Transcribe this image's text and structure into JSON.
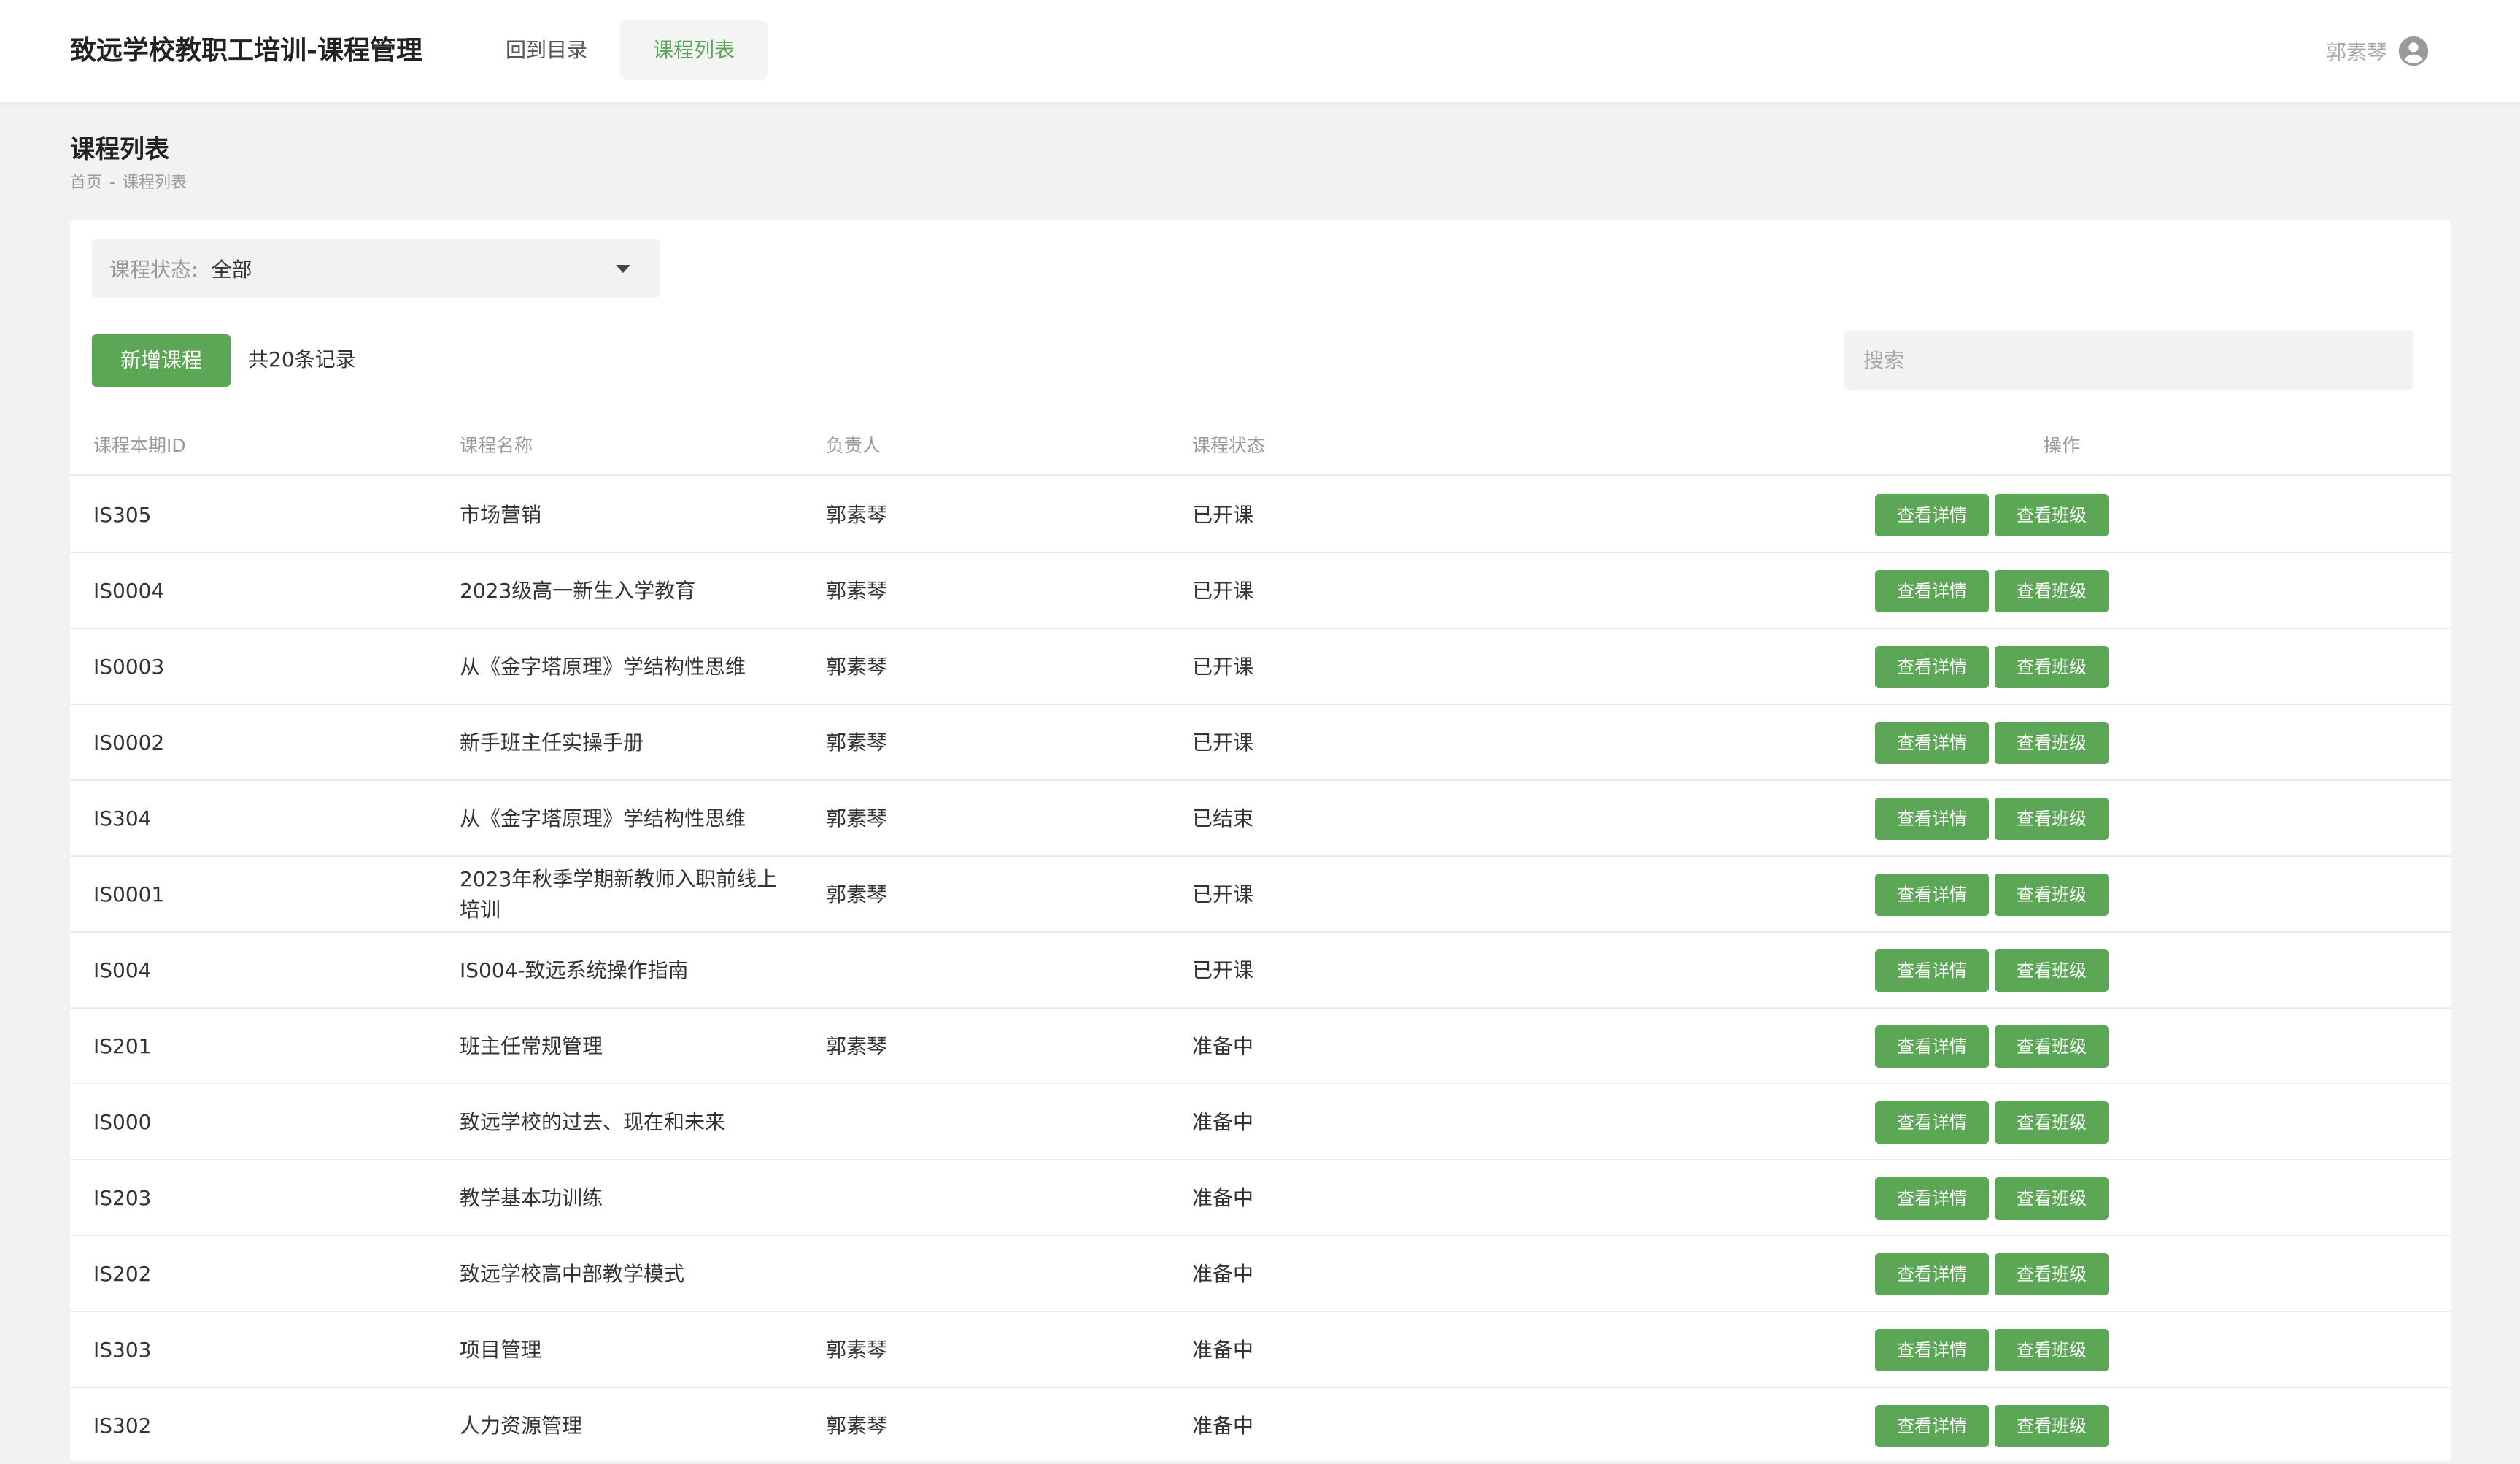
{
  "header": {
    "app_title": "致远学校教职工培训-课程管理",
    "nav": [
      {
        "label": "回到目录",
        "active": false
      },
      {
        "label": "课程列表",
        "active": true
      }
    ],
    "user_name": "郭素琴",
    "user_icon": "account-circle-icon"
  },
  "page": {
    "title": "课程列表",
    "breadcrumb": [
      "首页",
      "-",
      "课程列表"
    ]
  },
  "filter": {
    "label": "课程状态:",
    "value": "全部",
    "icon": "caret-down-icon"
  },
  "toolbar": {
    "add_label": "新增课程",
    "total_text": "共20条记录",
    "search_placeholder": "搜索"
  },
  "table": {
    "columns": [
      "课程本期ID",
      "课程名称",
      "负责人",
      "课程状态",
      "操作"
    ],
    "action_labels": {
      "detail": "查看详情",
      "class": "查看班级"
    },
    "rows": [
      {
        "id": "IS305",
        "name": "市场营销",
        "owner": "郭素琴",
        "status": "已开课"
      },
      {
        "id": "IS0004",
        "name": "2023级高一新生入学教育",
        "owner": "郭素琴",
        "status": "已开课"
      },
      {
        "id": "IS0003",
        "name": "从《金字塔原理》学结构性思维",
        "owner": "郭素琴",
        "status": "已开课"
      },
      {
        "id": "IS0002",
        "name": "新手班主任实操手册",
        "owner": "郭素琴",
        "status": "已开课"
      },
      {
        "id": "IS304",
        "name": "从《金字塔原理》学结构性思维",
        "owner": "郭素琴",
        "status": "已结束"
      },
      {
        "id": "IS0001",
        "name": "2023年秋季学期新教师入职前线上培训",
        "owner": "郭素琴",
        "status": "已开课"
      },
      {
        "id": "IS004",
        "name": "IS004-致远系统操作指南",
        "owner": "",
        "status": "已开课"
      },
      {
        "id": "IS201",
        "name": "班主任常规管理",
        "owner": "郭素琴",
        "status": "准备中"
      },
      {
        "id": "IS000",
        "name": "致远学校的过去、现在和未来",
        "owner": "",
        "status": "准备中"
      },
      {
        "id": "IS203",
        "name": "教学基本功训练",
        "owner": "",
        "status": "准备中"
      },
      {
        "id": "IS202",
        "name": "致远学校高中部教学模式",
        "owner": "",
        "status": "准备中"
      },
      {
        "id": "IS303",
        "name": "项目管理",
        "owner": "郭素琴",
        "status": "准备中"
      },
      {
        "id": "IS302",
        "name": "人力资源管理",
        "owner": "郭素琴",
        "status": "准备中"
      }
    ]
  },
  "colors": {
    "accent": "#5ba755",
    "page_bg": "#f2f2f2",
    "muted_text": "#9a9a9a"
  }
}
